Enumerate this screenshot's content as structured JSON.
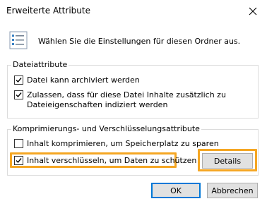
{
  "window": {
    "title": "Erweiterte Attribute"
  },
  "header": {
    "text": "Wählen Sie die Einstellungen für diesen Ordner aus.",
    "icon": "settings-list-icon"
  },
  "file_attributes": {
    "label": "Dateiattribute",
    "archive": {
      "label": "Datei kann archiviert werden",
      "checked": true
    },
    "index": {
      "label_line1": "Zulassen, dass für diese Datei Inhalte zusätzlich zu",
      "label_line2": "Dateieigenschaften indiziert werden",
      "checked": true
    }
  },
  "compress_encrypt": {
    "label": "Komprimierungs- und Verschlüsselungsattribute",
    "compress": {
      "label": "Inhalt komprimieren, um Speicherplatz zu sparen",
      "checked": false
    },
    "encrypt": {
      "label": "Inhalt verschlüsseln, um Daten zu schützen",
      "checked": true
    },
    "details_button": "Details"
  },
  "buttons": {
    "ok": "OK",
    "cancel": "Abbrechen"
  },
  "colors": {
    "highlight": "#f5a623",
    "default_button_border": "#0078d7",
    "button_face": "#e1e1e1"
  }
}
